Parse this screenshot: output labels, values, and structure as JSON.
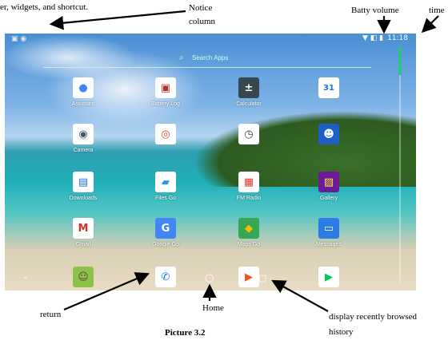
{
  "annotations": {
    "top_left": "er, widgets, and shortcut.",
    "notice": [
      "Notice",
      "column"
    ],
    "battery": "Batty volume",
    "time": "time",
    "return": "return",
    "home": "Home",
    "recent": [
      "display recently browsed",
      "history"
    ]
  },
  "caption": "Picture 3.2",
  "status_bar": {
    "time": "11:18",
    "left_icons": "▣ ◉",
    "right_icons": "▼ ◧ ▮"
  },
  "search": {
    "placeholder": "Search Apps",
    "icon": "search-icon"
  },
  "apps": [
    {
      "label": "Assistant",
      "glyph": "●",
      "bg": "#ffffff",
      "fg": "#4285f4"
    },
    {
      "label": "Battery Log",
      "glyph": "▣",
      "bg": "#ffffff",
      "fg": "#b03030"
    },
    {
      "label": "Calculator",
      "glyph": "±",
      "bg": "#37474f",
      "fg": "#ffffff"
    },
    {
      "label": "",
      "glyph": "31",
      "bg": "#ffffff",
      "fg": "#1a73e8"
    },
    {
      "label": "Camera",
      "glyph": "◉",
      "bg": "#ffffff",
      "fg": "#455a64"
    },
    {
      "label": "",
      "glyph": "◎",
      "bg": "#ffffff",
      "fg": "#db4437"
    },
    {
      "label": "",
      "glyph": "◷",
      "bg": "#ffffff",
      "fg": "#37474f"
    },
    {
      "label": "",
      "glyph": "☻",
      "bg": "#1e5fc7",
      "fg": "#ffffff"
    },
    {
      "label": "Downloads",
      "glyph": "▤",
      "bg": "#ffffff",
      "fg": "#1a73e8"
    },
    {
      "label": "Files Go",
      "glyph": "▰",
      "bg": "#ffffff",
      "fg": "#2196f3"
    },
    {
      "label": "FM Radio",
      "glyph": "▦",
      "bg": "#ffffff",
      "fg": "#e53935"
    },
    {
      "label": "Gallery",
      "glyph": "▨",
      "bg": "#6a1b9a",
      "fg": "#ffeb3b"
    },
    {
      "label": "Gmail",
      "glyph": "M",
      "bg": "#ffffff",
      "fg": "#d93025"
    },
    {
      "label": "Google Go",
      "glyph": "G",
      "bg": "#4285f4",
      "fg": "#ffffff"
    },
    {
      "label": "Maps Go",
      "glyph": "◆",
      "bg": "#34a853",
      "fg": "#fbbc05"
    },
    {
      "label": "Messages",
      "glyph": "▭",
      "bg": "#2d7be5",
      "fg": "#ffffff"
    },
    {
      "label": "",
      "glyph": "☺",
      "bg": "#8bc34a",
      "fg": "#5d4037"
    },
    {
      "label": "",
      "glyph": "✆",
      "bg": "#ffffff",
      "fg": "#1a73e8"
    },
    {
      "label": "",
      "glyph": "▶",
      "bg": "#ffffff",
      "fg": "#f4511e"
    },
    {
      "label": "",
      "glyph": "▶",
      "bg": "#ffffff",
      "fg": "#00c853"
    }
  ],
  "nav": {
    "home_glyph": "○",
    "recent_glyph": "□",
    "back_glyph": "⌄"
  }
}
